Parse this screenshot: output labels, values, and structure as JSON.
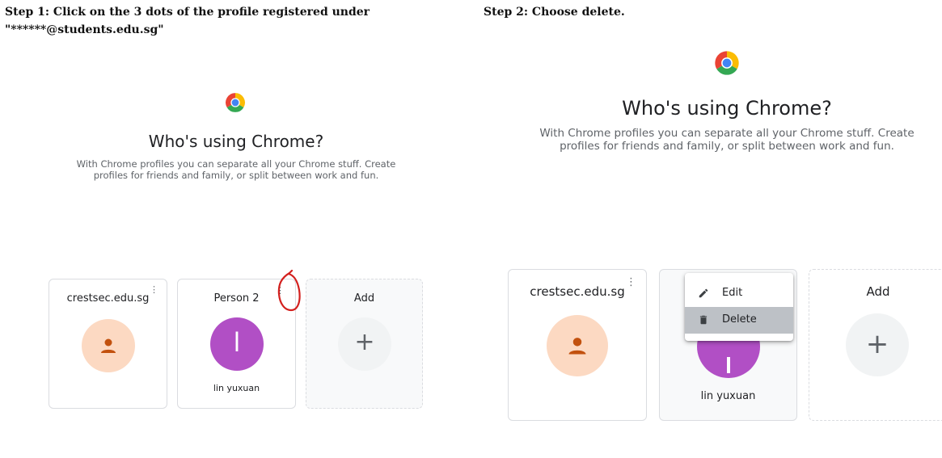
{
  "step1": {
    "instruction": "Step 1: Click on the 3 dots of the profile registered under \"******@students.edu.sg\"",
    "picker": {
      "heading": "Who's using Chrome?",
      "subtext": "With Chrome profiles you can separate all your Chrome stuff. Create profiles for friends and family, or split between work and fun.",
      "profiles": [
        {
          "title": "crestsec.edu.sg",
          "name": ""
        },
        {
          "title": "Person 2",
          "initial": "l",
          "name": "lin yuxuan"
        }
      ],
      "add_label": "Add",
      "add_symbol": "+",
      "menu_symbol": "⋮"
    }
  },
  "step2": {
    "instruction": "Step 2: Choose delete.",
    "picker": {
      "heading": "Who's using Chrome?",
      "subtext": "With Chrome profiles you can separate all your Chrome stuff. Create profiles for friends and family, or split between work and fun.",
      "profiles": [
        {
          "title": "crestsec.edu.sg"
        },
        {
          "title": "",
          "name": "lin yuxuan"
        }
      ],
      "add_label": "Add",
      "add_symbol": "+",
      "menu_symbol": "⋮",
      "context_menu": {
        "items": [
          {
            "label": "Edit",
            "icon": "pencil-icon"
          },
          {
            "label": "Delete",
            "icon": "trash-icon",
            "highlighted": true
          }
        ]
      }
    }
  },
  "colors": {
    "avatar_peach": "#fcd9c2",
    "avatar_person": "#c2510e",
    "avatar_purple": "#b14fc5",
    "add_circle": "#f1f3f4",
    "annotation_red": "#d3201e",
    "menu_highlight": "#bdc1c6"
  }
}
